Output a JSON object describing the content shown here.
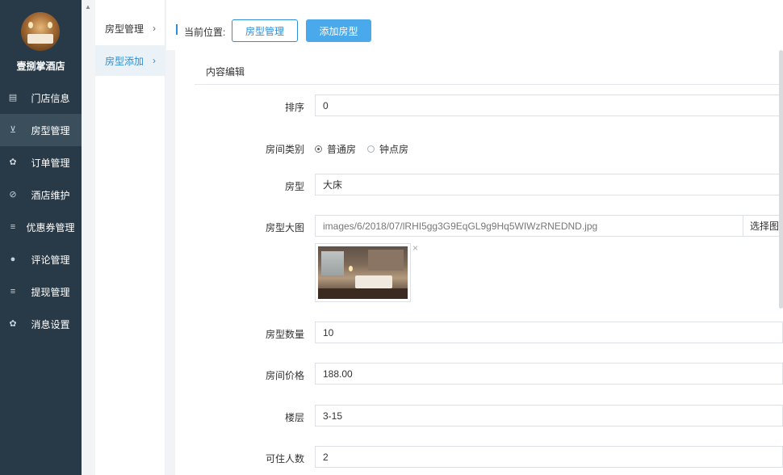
{
  "sidebar": {
    "hotel_name": "壹捌掌酒店",
    "items": [
      {
        "label": "门店信息",
        "icon": "id-card-icon",
        "glyph": "▤",
        "active": false
      },
      {
        "label": "房型管理",
        "icon": "cart-icon",
        "glyph": "⊻",
        "active": true
      },
      {
        "label": "订单管理",
        "icon": "gear-icon",
        "glyph": "✿",
        "active": false
      },
      {
        "label": "酒店维护",
        "icon": "compass-icon",
        "glyph": "⊘",
        "active": false
      },
      {
        "label": "优惠券管理",
        "icon": "list-icon",
        "glyph": "≡",
        "active": false
      },
      {
        "label": "评论管理",
        "icon": "user-icon",
        "glyph": "●",
        "active": false
      },
      {
        "label": "提现管理",
        "icon": "list-icon",
        "glyph": "≡",
        "active": false
      },
      {
        "label": "消息设置",
        "icon": "gear-icon",
        "glyph": "✿",
        "active": false
      }
    ]
  },
  "subnav": {
    "items": [
      {
        "label": "房型管理",
        "active": false
      },
      {
        "label": "房型添加",
        "active": true
      }
    ],
    "chevron": "›"
  },
  "header": {
    "breadcrumb_label": "当前位置:",
    "crumb_button": "房型管理",
    "add_button": "添加房型"
  },
  "panel": {
    "title": "内容编辑"
  },
  "form": {
    "sort_label": "排序",
    "sort_value": "0",
    "category_label": "房间类别",
    "category_options": [
      "普通房",
      "钟点房"
    ],
    "category_selected": "普通房",
    "room_type_label": "房型",
    "room_type_value": "大床",
    "image_label": "房型大图",
    "image_value": "images/6/2018/07/lRHI5gg3G9EqGL9g9Hq5WIWzRNEDND.jpg",
    "image_button": "选择图片",
    "image_close": "×",
    "quantity_label": "房型数量",
    "quantity_value": "10",
    "price_label": "房间价格",
    "price_value": "188.00",
    "floor_label": "楼层",
    "floor_value": "3-15",
    "capacity_label": "可住人数",
    "capacity_value": "2"
  },
  "colors": {
    "sidebar_bg": "#283a47",
    "sidebar_active": "#3b4e5c",
    "accent": "#2d8fd6",
    "primary_button": "#4aa9ea"
  }
}
